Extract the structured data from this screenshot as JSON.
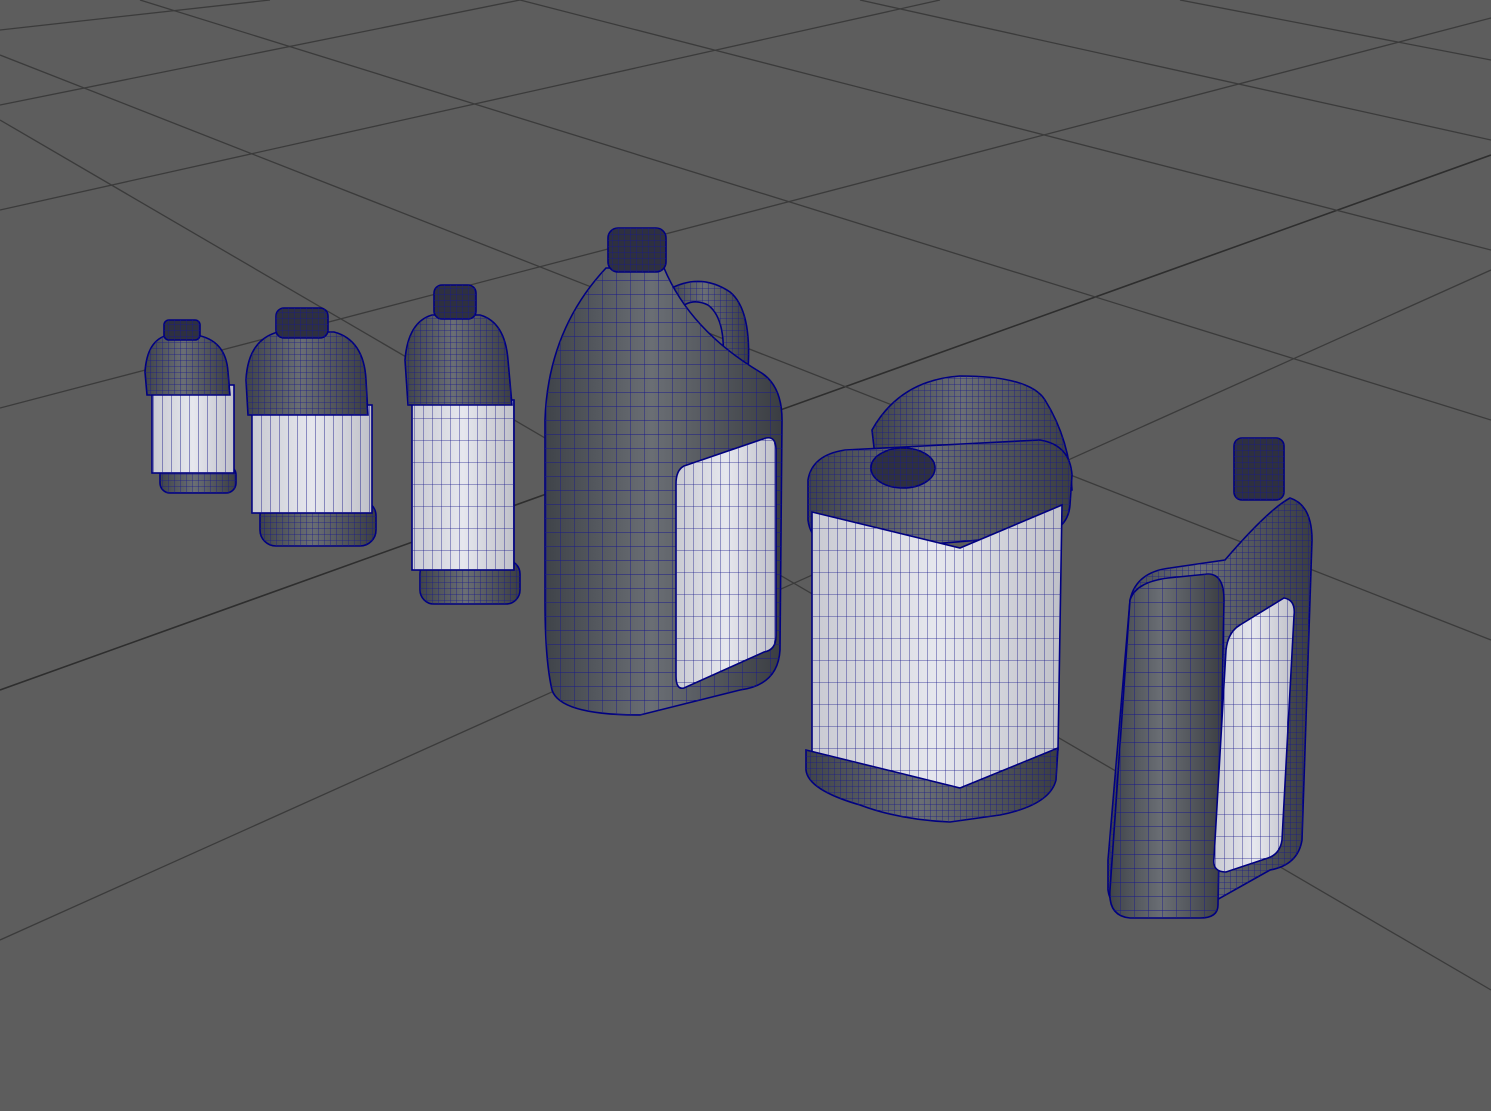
{
  "viewport": {
    "background_color": "#5d5d5d",
    "grid_color": "#3b3b3b",
    "wireframe_color": "#000080",
    "body_color": "#55595e",
    "label_color": "#d8d9e0"
  },
  "objects": [
    {
      "name": "small-bottle"
    },
    {
      "name": "medium-bottle"
    },
    {
      "name": "tall-bottle"
    },
    {
      "name": "handle-jug"
    },
    {
      "name": "square-canister"
    },
    {
      "name": "flat-oil-bottle"
    }
  ]
}
